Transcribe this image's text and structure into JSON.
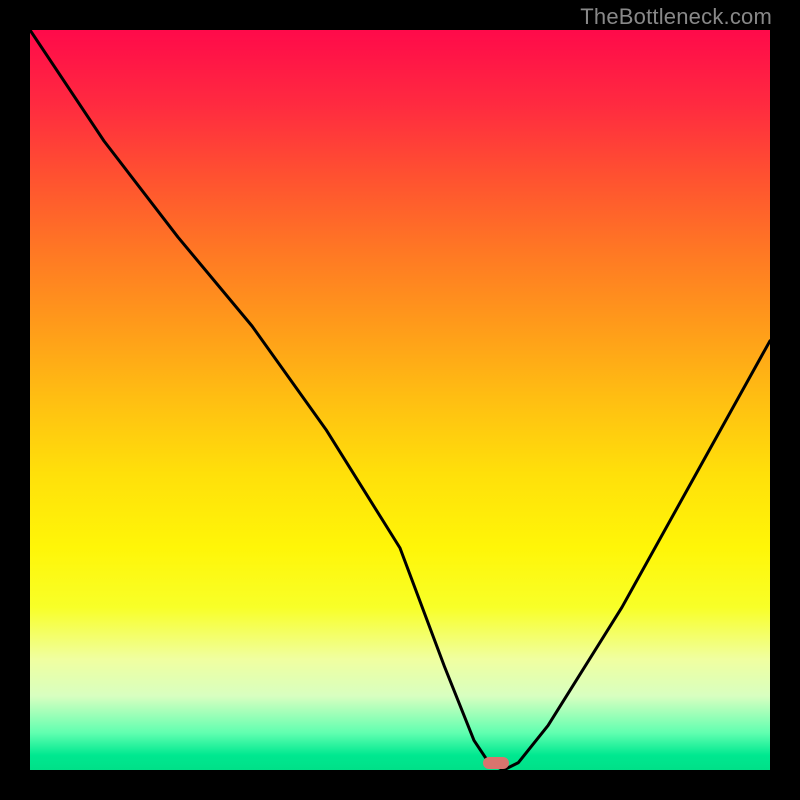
{
  "watermark": "TheBottleneck.com",
  "chart_data": {
    "type": "line",
    "title": "",
    "xlabel": "",
    "ylabel": "",
    "xlim": [
      0,
      100
    ],
    "ylim": [
      0,
      100
    ],
    "grid": false,
    "series": [
      {
        "name": "curve",
        "x": [
          0,
          10,
          20,
          30,
          40,
          50,
          56,
          60,
          62,
          64,
          66,
          70,
          80,
          90,
          100
        ],
        "values": [
          100,
          85,
          72,
          60,
          46,
          30,
          14,
          4,
          1,
          0,
          1,
          6,
          22,
          40,
          58
        ]
      }
    ],
    "marker": {
      "x": 63,
      "y": 1,
      "color": "#d9746e"
    },
    "colors": {
      "curve": "#000000",
      "gradient_top": "#ff0a4a",
      "gradient_mid": "#ffe00a",
      "gradient_bot": "#00e088",
      "background": "#000000"
    }
  }
}
